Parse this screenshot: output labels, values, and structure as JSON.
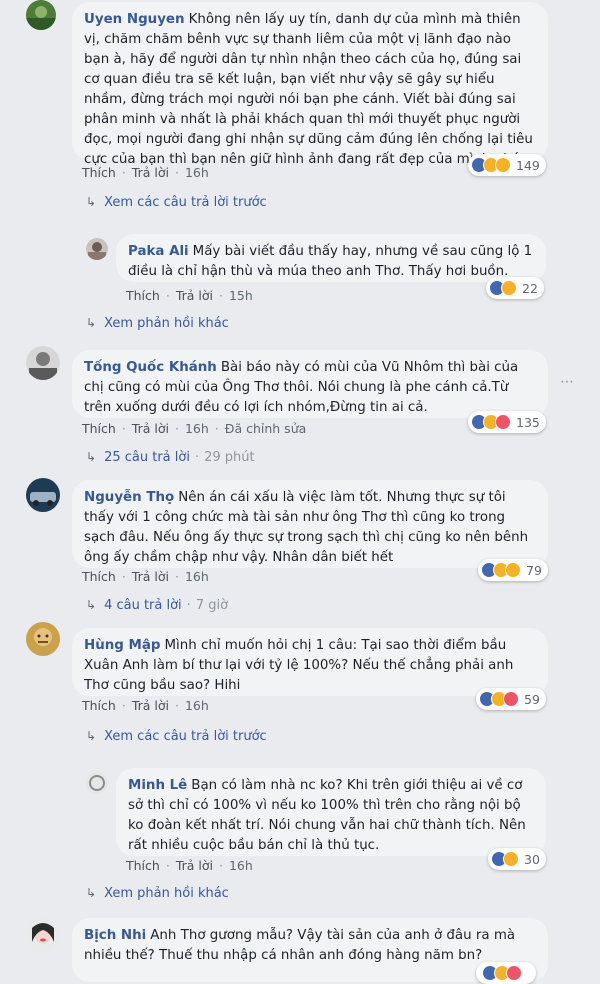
{
  "comments": [
    {
      "name": "Uyen Nguyen",
      "text": "Không nên lấy uy tín, danh dự của mình mà thiên vị, chăm chăm bênh vực sự thanh liêm của một vị lãnh đạo nào bạn à, hãy để người dân tự nhìn nhận theo cách của họ, đúng sai cơ quan điều tra sẽ kết luận, bạn viết như vậy sẽ gây sự hiểu nhầm, đừng trách mọi người nói bạn phe cánh. Viết bài đúng sai phân minh và nhất là phải khách quan thì mới thuyết phục người đọc, mọi người đang ghi nhận sự dũng cảm đúng lên chống lại tiêu cực của bạn thì bạn nên giữ hình ảnh đang rất đẹp của mình nhé,",
      "like": "Thích",
      "reply": "Trả lời",
      "time": "16h",
      "reactions": "149",
      "reply_link": "Xem các câu trả lời trước"
    },
    {
      "name": "Paka Ali",
      "text": "Mấy bài viết đầu thấy hay, nhưng về sau cũng lộ 1 điều là chỉ hận thù và múa theo anh Thơ. Thấy hơi buồn.",
      "like": "Thích",
      "reply": "Trả lời",
      "time": "15h",
      "reactions": "22",
      "reply_link": "Xem phản hồi khác"
    },
    {
      "name": "Tống Quốc Khánh",
      "text": "Bài báo này có mùi của Vũ Nhôm thì bài của chị cũng có mùi của Ông Thơ thôi. Nói chung là phe cánh cả.Từ trên xuống dưới đều có lợi ích nhóm,Đừng tin ai cả.",
      "like": "Thích",
      "reply": "Trả lời",
      "time": "16h",
      "edited": "Đã chỉnh sửa",
      "reactions": "135",
      "reply_link": "25 câu trả lời",
      "reply_time": "29 phút"
    },
    {
      "name": "Nguyễn Thọ",
      "text": "Nên án cái xấu là việc làm tốt. Nhưng thực sự tôi thấy với 1 công chức mà tài sản như ông Thơ thì cũng ko trong sạch đâu. Nếu ông ấy thực sự trong sạch thì chị cũng ko nên bênh ông ấy chầm chập như vậy. Nhân dân biết hết",
      "like": "Thích",
      "reply": "Trả lời",
      "time": "16h",
      "reactions": "79",
      "reply_link": "4 câu trả lời",
      "reply_time": "7 giờ"
    },
    {
      "name": "Hùng Mập",
      "text": "Mình chỉ muốn hỏi chị 1 câu: Tại sao thời điểm bầu Xuân Anh làm bí thư lại với tỷ lệ 100%? Nếu thế chẳng phải anh Thơ cũng bầu sao? Hihi",
      "like": "Thích",
      "reply": "Trả lời",
      "time": "16h",
      "reactions": "59",
      "reply_link": "Xem các câu trả lời trước"
    },
    {
      "name": "Minh Lê",
      "text": "Bạn có làm nhà nc ko? Khi trên giới thiệu ai về cơ sở thì chỉ có 100% vì nếu ko 100% thì trên cho rằng nội bộ ko đoàn kết nhất trí. Nói chung vẫn hai chữ thành tích. Nên rất nhiều cuộc bầu bán chỉ là thủ tục.",
      "like": "Thích",
      "reply": "Trả lời",
      "time": "16h",
      "reactions": "30",
      "reply_link": "Xem phản hồi khác"
    },
    {
      "name": "Bịch Nhi",
      "text": "Anh Thơ gương mẫu? Vậy tài sản của anh ở đâu ra mà nhiều thế? Thuế thu nhập cá nhân anh đóng hàng năm bn?"
    }
  ],
  "icons": {
    "more": "more-options-icon",
    "reply_arrow": "reply-arrow-icon"
  },
  "colors": {
    "name": "#385898",
    "bubble": "#f2f3f5",
    "background": "#e9ebee",
    "like": "#4267b2",
    "haha": "#f7b125",
    "love": "#f25268"
  }
}
